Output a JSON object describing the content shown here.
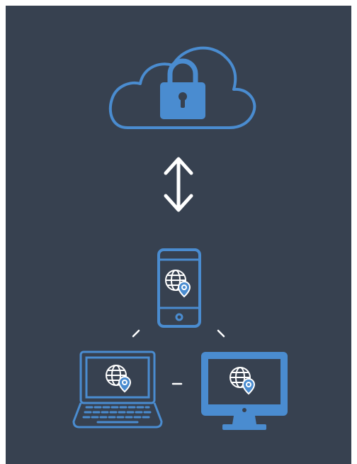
{
  "colors": {
    "background": "#374150",
    "accent": "#4a8cd0",
    "arrow": "#ffffff",
    "connector": "#ffffff"
  },
  "nodes": {
    "cloud": {
      "icon": "cloud-lock-icon"
    },
    "phone": {
      "icon": "smartphone-globe-pin-icon"
    },
    "laptop": {
      "icon": "laptop-globe-pin-icon"
    },
    "desktop": {
      "icon": "monitor-globe-pin-icon"
    }
  },
  "links": [
    {
      "from": "cloud",
      "to": "devices",
      "icon": "bidirectional-arrow-icon"
    },
    {
      "from": "phone",
      "to": "laptop"
    },
    {
      "from": "phone",
      "to": "desktop"
    },
    {
      "from": "laptop",
      "to": "desktop"
    }
  ]
}
